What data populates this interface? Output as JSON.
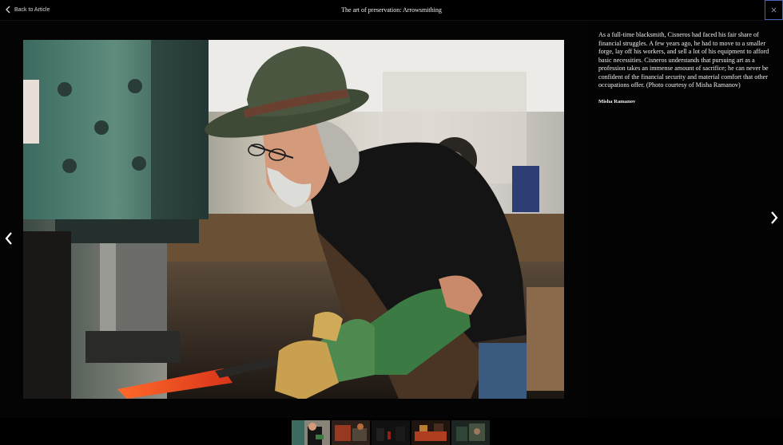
{
  "header": {
    "back_label": "Back to Article",
    "title": "The art of preservation: Arrowsmithing"
  },
  "icons": {
    "back": "chevron-left-icon",
    "close": "close-icon",
    "prev": "chevron-left-icon",
    "next": "chevron-right-icon"
  },
  "caption": {
    "text": "As a full-time blacksmith, Cisneros had faced his fair share of financial struggles. A few years ago, he had to move to a smaller forge, lay off his workers, and sell a lot of his equipment to afford basic necessities. Cisneros understands that pursuing art as a profession takes an immense amount of sacrifice; he can never be confident of the financial security and material comfort that other occupations offer. (Photo courtesy of Misha Ramanov)",
    "credit": "Misha Ramanov"
  },
  "filmstrip": {
    "count": 5,
    "active_index": 0
  },
  "colors": {
    "background": "#000000",
    "close_border": "#4a64b6",
    "text": "#f0f0f0"
  }
}
